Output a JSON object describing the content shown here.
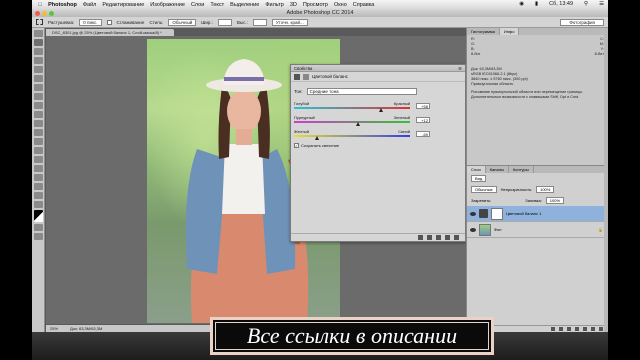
{
  "menubar": {
    "app": "Photoshop",
    "items": [
      "Файл",
      "Редактирование",
      "Изображение",
      "Слои",
      "Текст",
      "Выделение",
      "Фильтр",
      "3D",
      "Просмотр",
      "Окно",
      "Справка"
    ],
    "clock": "Сб, 13:49"
  },
  "window": {
    "title": "Adobe Photoshop CC 2014"
  },
  "options": {
    "feather_label": "Растушевка:",
    "feather_value": "0 пикс.",
    "antialias_label": "Сглаживание",
    "style_label": "Стиль:",
    "style_value": "Обычный",
    "width_label": "Шир.:",
    "height_label": "Выс.:",
    "refine_label": "Уточн. край...",
    "workspace": "Фотография"
  },
  "document": {
    "tab": "DSC_8301.jpg @ 25% (Цветовой баланс 1, Слой-маска/8) *",
    "zoom": "25%",
    "doc_size": "Док: 63,3M/63,3M"
  },
  "properties": {
    "title": "Свойства",
    "panel_name": "Цветовой баланс",
    "tone_label": "Тон:",
    "tone_value": "Средние тона",
    "sliders": [
      {
        "left": "Голубой",
        "right": "Красный",
        "value": "+58",
        "pos": 0.75
      },
      {
        "left": "Пурпурный",
        "right": "Зеленый",
        "value": "+12",
        "pos": 0.55
      },
      {
        "left": "Желтый",
        "right": "Синий",
        "value": "-69",
        "pos": 0.2
      }
    ],
    "preserve_label": "Сохранить свечение"
  },
  "right_panel": {
    "tabs": [
      "Гистограмма",
      "Инфо"
    ],
    "info_rows": [
      [
        "R:",
        "C:"
      ],
      [
        "G:",
        "M:"
      ],
      [
        "B:",
        "Y:"
      ],
      [
        "8-бит",
        "8-бит"
      ]
    ],
    "info_text": [
      "Док: 63,3M/63,3M",
      "sRGB IEC61966-2.1 (8bpc)",
      "3840 пикс. x 5760 пикс. (300 ppi)",
      "Прямоугольная область",
      "Рисование прямоугольной области или перемещение границы.",
      "Дополнительные возможности с клавишами Shift, Opt и Cmd."
    ]
  },
  "layers_panel": {
    "tabs": [
      "Слои",
      "Каналы",
      "Контуры"
    ],
    "kind": "Вид",
    "blend": "Обычные",
    "opacity_label": "Непрозрачность:",
    "opacity": "100%",
    "lock_label": "Закрепить:",
    "fill_label": "Заливка:",
    "fill": "100%",
    "layers": [
      {
        "name": "Цветовой баланс 1",
        "active": true
      },
      {
        "name": "Фон",
        "active": false
      }
    ]
  },
  "overlay": {
    "caption": "Все ссылки в описании"
  }
}
